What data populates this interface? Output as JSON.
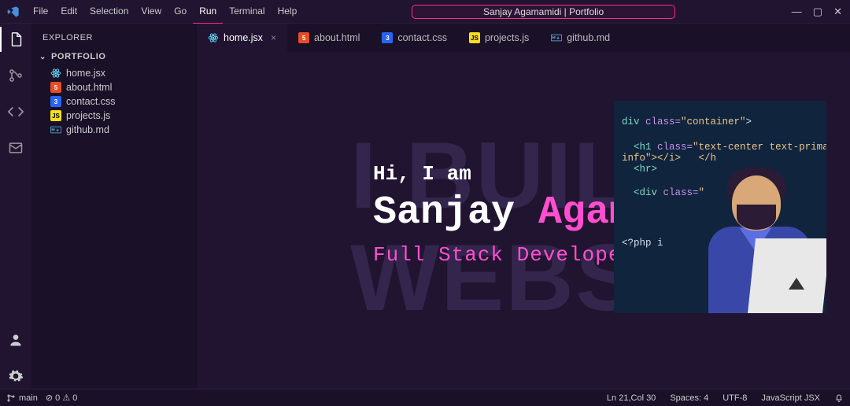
{
  "window": {
    "title": "Sanjay Agamamidi | Portfolio"
  },
  "menus": [
    "File",
    "Edit",
    "Selection",
    "View",
    "Go",
    "Run",
    "Terminal",
    "Help"
  ],
  "menus_active": "Run",
  "explorer": {
    "header": "EXPLORER",
    "section": "PORTFOLIO",
    "files": [
      {
        "icon": "react",
        "name": "home.jsx"
      },
      {
        "icon": "html",
        "name": "about.html"
      },
      {
        "icon": "css",
        "name": "contact.css"
      },
      {
        "icon": "js",
        "name": "projects.js"
      },
      {
        "icon": "md",
        "name": "github.md"
      }
    ]
  },
  "tabs": [
    {
      "icon": "react",
      "name": "home.jsx",
      "active": true,
      "closable": true
    },
    {
      "icon": "html",
      "name": "about.html",
      "active": false
    },
    {
      "icon": "css",
      "name": "contact.css",
      "active": false
    },
    {
      "icon": "js",
      "name": "projects.js",
      "active": false
    },
    {
      "icon": "md",
      "name": "github.md",
      "active": false
    }
  ],
  "hero": {
    "bg_line1": "I BUILD",
    "bg_line2": "WEBSIT",
    "hi": "Hi, I am",
    "first_name": "Sanjay",
    "last_name": "Agamamidi",
    "role": "Full Stack Developer"
  },
  "illustration_code": {
    "l1a": "div",
    "l1b": " class=",
    "l1c": "\"container\"",
    "l1d": ">",
    "l2a": "<h1",
    "l2b": " class=",
    "l2c": "\"text-center text-prima",
    "l2d": "",
    "l3": "info\"></i>   </h",
    "l4": "<hr>",
    "l5a": "<div",
    "l5b": " class=",
    "l5c": "\"",
    "l6": "<?php i                 while(ha"
  },
  "statusbar": {
    "branch": "main",
    "errors": "0",
    "warnings": "0",
    "ln_col": "Ln 21,Col 30",
    "spaces": "Spaces: 4",
    "encoding": "UTF-8",
    "lang": "JavaScript JSX"
  }
}
